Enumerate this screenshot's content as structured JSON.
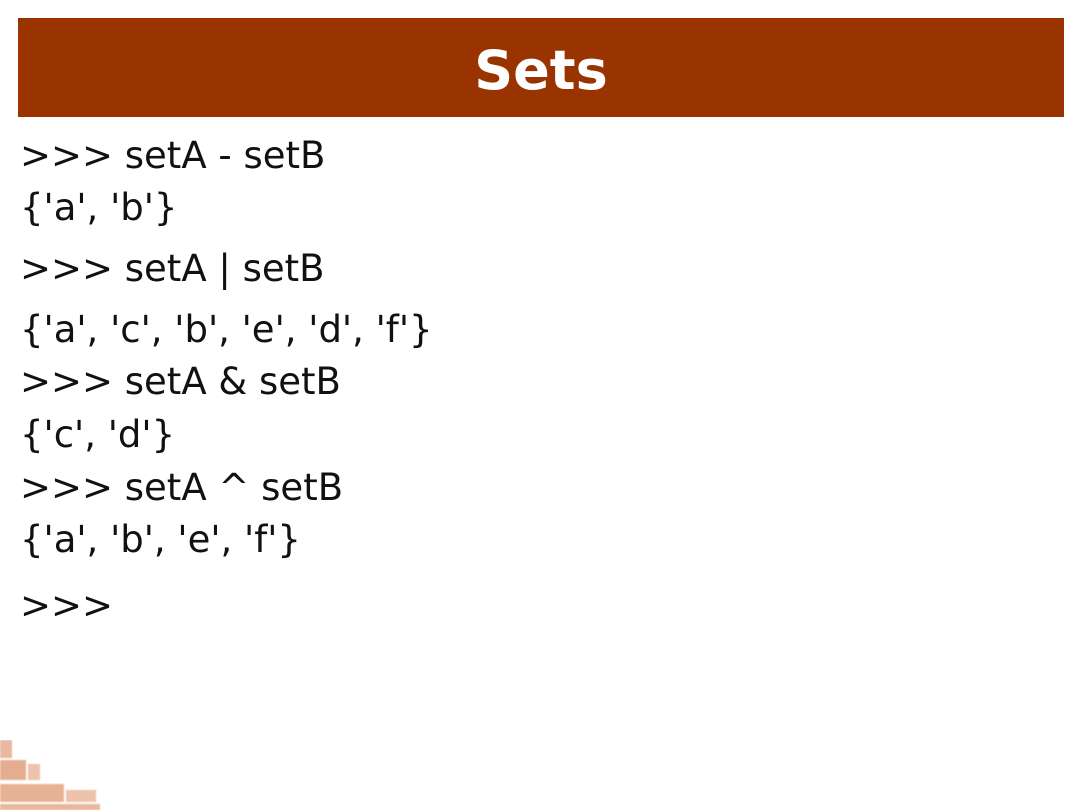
{
  "slide": {
    "title": "Sets",
    "lines": [
      ">>> setA - setB",
      "{'a', 'b'}",
      ">>> setA | setB",
      "{'a', 'c', 'b', 'e', 'd', 'f'}",
      ">>> setA & setB",
      "{'c', 'd'}",
      ">>> setA ^ setB",
      "{'a', 'b', 'e', 'f'}",
      ">>>"
    ]
  },
  "colors": {
    "title_bar": "#993300",
    "title_text": "#ffffff",
    "body_text": "#111111"
  },
  "icons": [
    "brick-wall-icon"
  ]
}
